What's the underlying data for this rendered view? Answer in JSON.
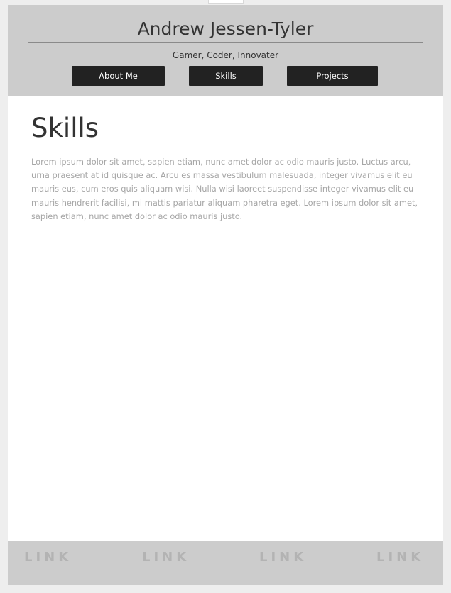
{
  "header": {
    "title": "Andrew Jessen-Tyler",
    "tagline": "Gamer, Coder, Innovater",
    "nav": [
      {
        "label": "About Me"
      },
      {
        "label": "Skills"
      },
      {
        "label": "Projects"
      }
    ]
  },
  "main": {
    "heading": "Skills",
    "body": "Lorem ipsum dolor sit amet, sapien etiam, nunc amet dolor ac odio mauris justo. Luctus arcu, urna praesent at id quisque ac. Arcu es massa vestibulum malesuada, integer vivamus elit eu mauris eus, cum eros quis aliquam wisi. Nulla wisi laoreet suspendisse integer vivamus elit eu mauris hendrerit facilisi, mi mattis pariatur aliquam pharetra eget. Lorem ipsum dolor sit amet, sapien etiam, nunc amet dolor ac odio mauris justo."
  },
  "footer": {
    "links": [
      {
        "label": "LINK"
      },
      {
        "label": "LINK"
      },
      {
        "label": "LINK"
      },
      {
        "label": "LINK"
      }
    ]
  },
  "colors": {
    "header_bg": "#cccccc",
    "button_bg": "#222222",
    "text_dark": "#333333",
    "text_muted": "#a6a6a6",
    "outer_bg": "#eeeeee"
  }
}
